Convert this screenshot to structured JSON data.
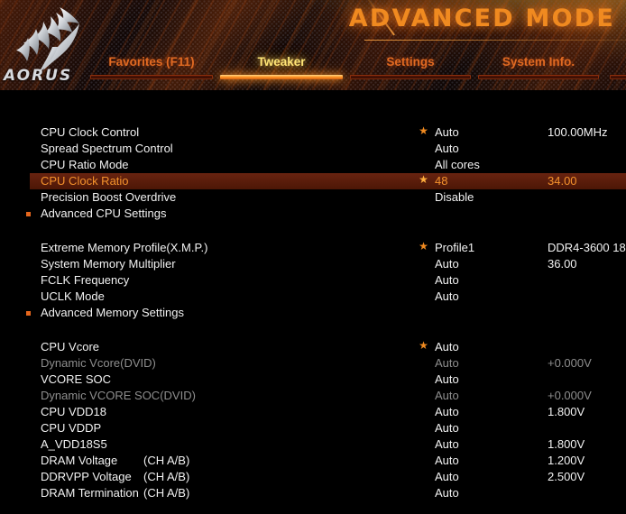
{
  "header": {
    "mode_title": "ADVANCED MODE",
    "brand": "AORUS",
    "logo_icon": "aorus-eagle-icon"
  },
  "nav": {
    "tabs": [
      {
        "label": "Favorites (F11)",
        "active": false
      },
      {
        "label": "Tweaker",
        "active": true
      },
      {
        "label": "Settings",
        "active": false
      },
      {
        "label": "System Info.",
        "active": false
      }
    ]
  },
  "settings": {
    "groups": [
      {
        "id": "cpu",
        "rows": [
          {
            "label": "CPU Clock Control",
            "channel": "",
            "value": "Auto",
            "detail": "100.00MHz",
            "star": true,
            "submenu": false,
            "dim": false,
            "selected": false
          },
          {
            "label": "Spread Spectrum Control",
            "channel": "",
            "value": "Auto",
            "detail": "",
            "star": false,
            "submenu": false,
            "dim": false,
            "selected": false
          },
          {
            "label": "CPU Ratio Mode",
            "channel": "",
            "value": "All cores",
            "detail": "",
            "star": false,
            "submenu": false,
            "dim": false,
            "selected": false
          },
          {
            "label": "CPU Clock Ratio",
            "channel": "",
            "value": "48",
            "detail": "34.00",
            "star": true,
            "submenu": false,
            "dim": false,
            "selected": true
          },
          {
            "label": "Precision Boost Overdrive",
            "channel": "",
            "value": "Disable",
            "detail": "",
            "star": false,
            "submenu": false,
            "dim": false,
            "selected": false
          },
          {
            "label": "Advanced CPU Settings",
            "channel": "",
            "value": "",
            "detail": "",
            "star": false,
            "submenu": true,
            "dim": false,
            "selected": false
          }
        ]
      },
      {
        "id": "memory",
        "rows": [
          {
            "label": "Extreme Memory Profile(X.M.P.)",
            "channel": "",
            "value": "Profile1",
            "detail": "DDR4-3600 18",
            "star": true,
            "submenu": false,
            "dim": false,
            "selected": false
          },
          {
            "label": "System Memory Multiplier",
            "channel": "",
            "value": "Auto",
            "detail": "36.00",
            "star": false,
            "submenu": false,
            "dim": false,
            "selected": false
          },
          {
            "label": "FCLK Frequency",
            "channel": "",
            "value": "Auto",
            "detail": "",
            "star": false,
            "submenu": false,
            "dim": false,
            "selected": false
          },
          {
            "label": "UCLK Mode",
            "channel": "",
            "value": "Auto",
            "detail": "",
            "star": false,
            "submenu": false,
            "dim": false,
            "selected": false
          },
          {
            "label": "Advanced Memory Settings",
            "channel": "",
            "value": "",
            "detail": "",
            "star": false,
            "submenu": true,
            "dim": false,
            "selected": false
          }
        ]
      },
      {
        "id": "voltage",
        "rows": [
          {
            "label": "CPU Vcore",
            "channel": "",
            "value": "Auto",
            "detail": "",
            "star": true,
            "submenu": false,
            "dim": false,
            "selected": false
          },
          {
            "label": "Dynamic Vcore(DVID)",
            "channel": "",
            "value": "Auto",
            "detail": "+0.000V",
            "star": false,
            "submenu": false,
            "dim": true,
            "selected": false
          },
          {
            "label": "VCORE SOC",
            "channel": "",
            "value": "Auto",
            "detail": "",
            "star": false,
            "submenu": false,
            "dim": false,
            "selected": false
          },
          {
            "label": "Dynamic VCORE SOC(DVID)",
            "channel": "",
            "value": "Auto",
            "detail": "+0.000V",
            "star": false,
            "submenu": false,
            "dim": true,
            "selected": false
          },
          {
            "label": "CPU VDD18",
            "channel": "",
            "value": "Auto",
            "detail": "1.800V",
            "star": false,
            "submenu": false,
            "dim": false,
            "selected": false
          },
          {
            "label": "CPU VDDP",
            "channel": "",
            "value": "Auto",
            "detail": "",
            "star": false,
            "submenu": false,
            "dim": false,
            "selected": false
          },
          {
            "label": "A_VDD18S5",
            "channel": "",
            "value": "Auto",
            "detail": "1.800V",
            "star": false,
            "submenu": false,
            "dim": false,
            "selected": false
          },
          {
            "label": "DRAM Voltage",
            "channel": "(CH A/B)",
            "value": "Auto",
            "detail": "1.200V",
            "star": false,
            "submenu": false,
            "dim": false,
            "selected": false
          },
          {
            "label": "DDRVPP Voltage",
            "channel": "(CH A/B)",
            "value": "Auto",
            "detail": "2.500V",
            "star": false,
            "submenu": false,
            "dim": false,
            "selected": false
          },
          {
            "label": "DRAM Termination",
            "channel": "(CH A/B)",
            "value": "Auto",
            "detail": "",
            "star": false,
            "submenu": false,
            "dim": false,
            "selected": false
          }
        ]
      }
    ]
  },
  "colors": {
    "accent_orange": "#f08a20",
    "selected_row_bg": "#5a1e08",
    "selected_text": "#f4922c",
    "active_tab_text": "#ffe97a",
    "inactive_tab_text": "#e06a22",
    "label_text": "#f2f2f2",
    "dim_text": "#8e8e8e",
    "background": "#000000"
  }
}
